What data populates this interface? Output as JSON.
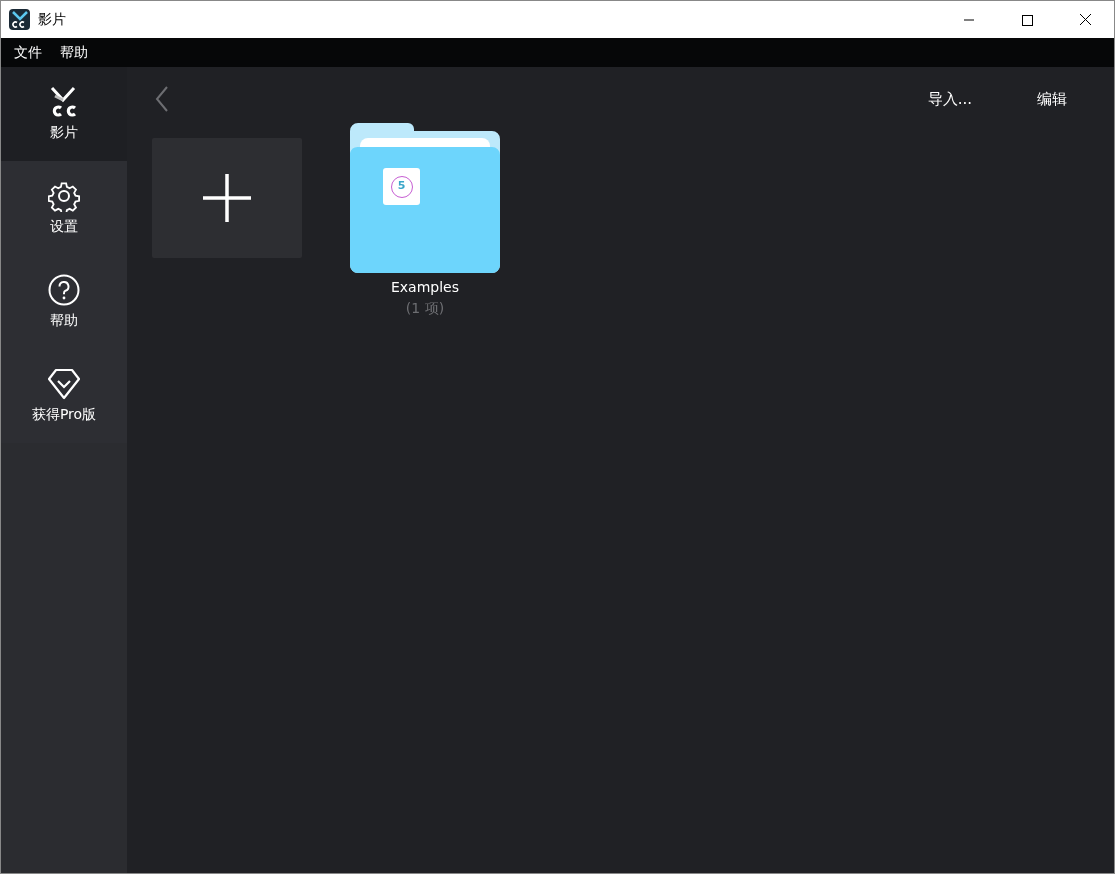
{
  "window": {
    "title": "影片"
  },
  "menu": [
    "文件",
    "帮助"
  ],
  "sidebar": {
    "items": [
      {
        "kind": "logo",
        "label": "影片",
        "selected": true
      },
      {
        "kind": "gear",
        "label": "设置",
        "selected": false
      },
      {
        "kind": "help",
        "label": "帮助",
        "selected": false
      },
      {
        "kind": "diamond",
        "label": "获得Pro版",
        "selected": false
      }
    ]
  },
  "toolbar": {
    "actions": [
      "导入...",
      "编辑"
    ]
  },
  "folders": [
    {
      "name": "Examples",
      "count": "(1 项)",
      "thumbnail_label": "5"
    }
  ]
}
